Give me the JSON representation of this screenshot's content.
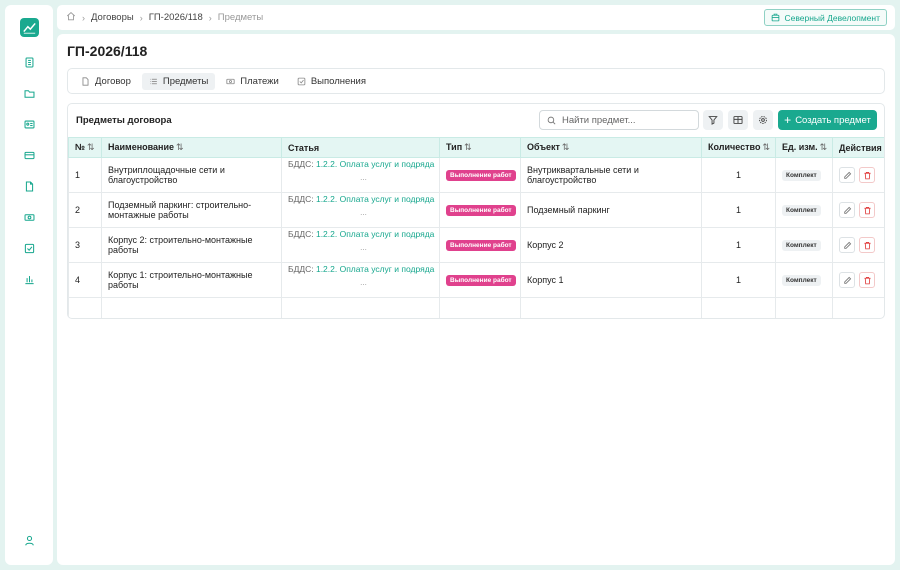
{
  "breadcrumb": {
    "items": [
      "Договоры",
      "ГП-2026/118",
      "Предметы"
    ]
  },
  "organization": "Северный Девелопмент",
  "page_title": "ГП-2026/118",
  "tabs": [
    {
      "label": "Договор",
      "icon": "file-icon"
    },
    {
      "label": "Предметы",
      "icon": "list-icon"
    },
    {
      "label": "Платежи",
      "icon": "payment-icon"
    },
    {
      "label": "Выполнения",
      "icon": "checkbox-icon"
    }
  ],
  "panel": {
    "title": "Предметы договора",
    "search_placeholder": "Найти предмет...",
    "create_label": "Создать предмет"
  },
  "table": {
    "columns": [
      "№",
      "Наименование",
      "Статья",
      "Тип",
      "Объект",
      "Количество",
      "Ед. изм.",
      "Действия"
    ],
    "rows": [
      {
        "num": "1",
        "name": "Внутриплощадочные сети и благоустройство",
        "budget_prefix": "БДДС:",
        "budget_link": "1.2.2. Оплата услуг и подряда",
        "budget_more": "...",
        "type": "Выполнение работ",
        "object": "Внутриквартальные сети и благоустройство",
        "qty": "1",
        "unit": "Комплект"
      },
      {
        "num": "2",
        "name": "Подземный паркинг: строительно-монтажные работы",
        "budget_prefix": "БДДС:",
        "budget_link": "1.2.2. Оплата услуг и подряда",
        "budget_more": "...",
        "type": "Выполнение работ",
        "object": "Подземный паркинг",
        "qty": "1",
        "unit": "Комплект"
      },
      {
        "num": "3",
        "name": "Корпус 2: строительно-монтажные работы",
        "budget_prefix": "БДДС:",
        "budget_link": "1.2.2. Оплата услуг и подряда",
        "budget_more": "...",
        "type": "Выполнение работ",
        "object": "Корпус 2",
        "qty": "1",
        "unit": "Комплект"
      },
      {
        "num": "4",
        "name": "Корпус 1: строительно-монтажные работы",
        "budget_prefix": "БДДС:",
        "budget_link": "1.2.2. Оплата услуг и подряда",
        "budget_more": "...",
        "type": "Выполнение работ",
        "object": "Корпус 1",
        "qty": "1",
        "unit": "Комплект"
      }
    ]
  },
  "colors": {
    "accent": "#1aa98f",
    "type_badge": "#e0418d",
    "delete": "#e03a3a"
  }
}
